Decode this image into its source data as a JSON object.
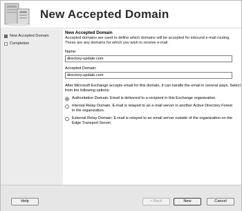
{
  "wizard": {
    "title": "New Accepted Domain",
    "icon": "computer-icon"
  },
  "steps": [
    {
      "label": "New Accepted Domain",
      "active": true
    },
    {
      "label": "Completion",
      "active": false
    }
  ],
  "page": {
    "heading": "New Accepted Domain",
    "description": "Accepted domains are used to define which domains will be accepted for inbound e-mail routing.  These are any domains for which you wish to receive e-mail.",
    "name_label": "Name:",
    "name_value": "directory-update.com",
    "domain_label": "Accepted Domain:",
    "domain_value": "directory-update.com",
    "after_text": "After Microsoft Exchange accepts email for this domain, it can handle the email in several ways.  Select from the following options:",
    "options": [
      {
        "label": "Authoritative Domain.  Email is delivered to a recipient in this Exchange organization.",
        "checked": true
      },
      {
        "label": "Internal Relay Domain.  E-mail is relayed to an e-mail server in another Active Directory Forest in the organization.",
        "checked": false
      },
      {
        "label": "External Relay Domain.  E-mail is relayed to an email server outside of the organization on the Edge Transport Server.",
        "checked": false
      }
    ]
  },
  "buttons": {
    "help": "Help",
    "back": "< Back",
    "new": "New",
    "cancel": "Cancel"
  }
}
